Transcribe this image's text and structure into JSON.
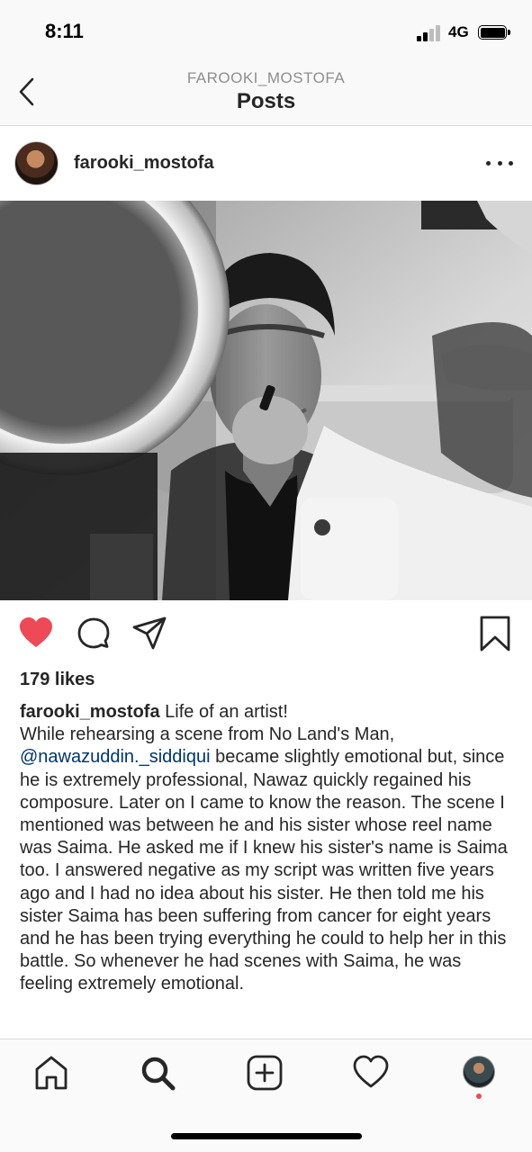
{
  "status_bar": {
    "time": "8:11",
    "network": "4G",
    "signal_bars": 2,
    "battery_level": 1.0
  },
  "nav": {
    "subtitle": "FAROOKI_MOSTOFA",
    "title": "Posts",
    "back_icon": "chevron-left-icon"
  },
  "post": {
    "username": "farooki_mostofa",
    "liked": true,
    "likes": "179 likes",
    "caption": {
      "author": "farooki_mostofa",
      "text_1": " Life of an artist!\nWhile rehearsing a scene from No Land's Man, ",
      "mention": "@nawazuddin._siddiqui",
      "text_2": " became slightly emotional but, since he is extremely professional, Nawaz quickly regained his composure. Later on I came to know the reason. The scene I mentioned was between he and his sister whose reel name was Saima. He asked me if I knew his sister's name is Saima too. I answered negative as my script was written five years ago and I had no idea about his sister. He then told me his sister Saima has been suffering from cancer for eight years and he has been trying everything he could to help her in this battle. So whenever he had scenes with Saima, he was feeling extremely emotional."
    }
  },
  "icons": {
    "like": "heart-filled-icon",
    "comment": "comment-bubble-icon",
    "share": "paper-plane-icon",
    "save": "bookmark-icon",
    "more": "more-horizontal-icon"
  },
  "tab_bar": [
    "home-icon",
    "search-icon",
    "add-post-icon",
    "activity-heart-icon",
    "profile-avatar"
  ],
  "colors": {
    "like": "#ed4956",
    "mention": "#003569",
    "text": "#262626",
    "muted": "#8e8e8e",
    "notification_dot": "#ed4956"
  }
}
